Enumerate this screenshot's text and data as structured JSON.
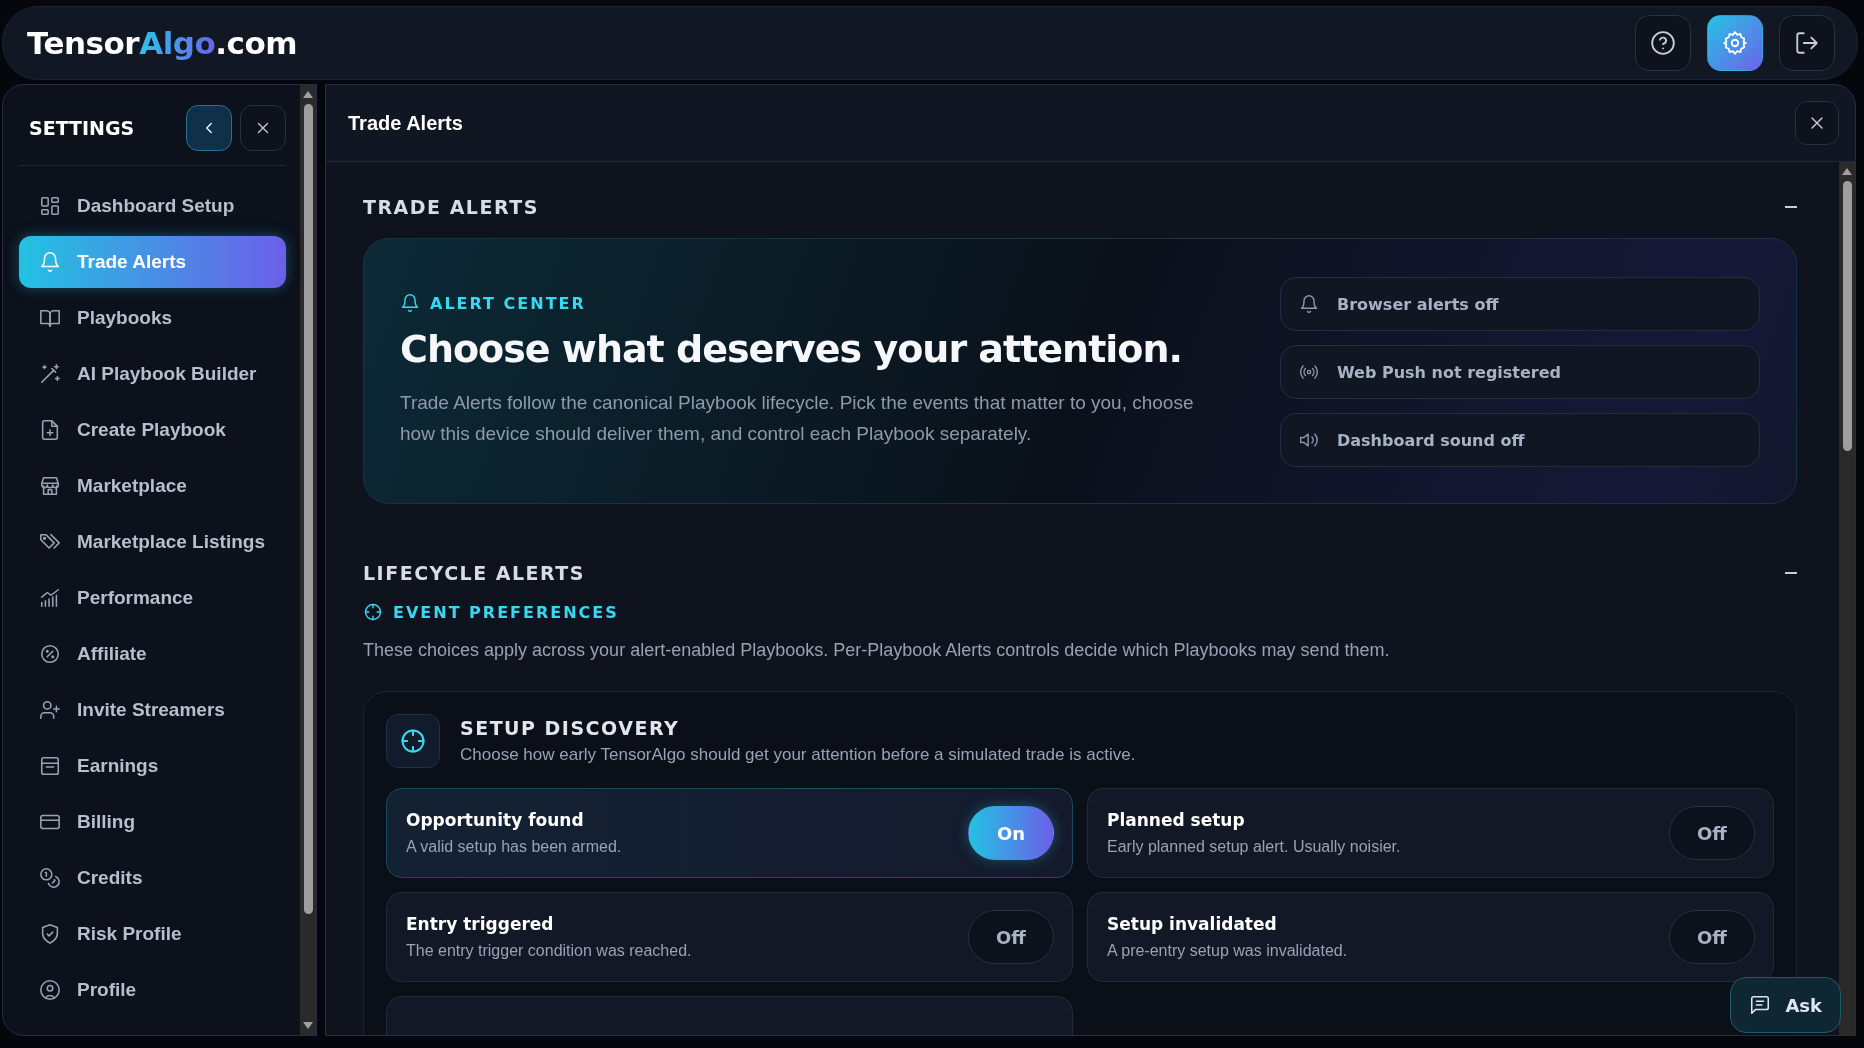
{
  "brand": [
    {
      "text": "Tensor",
      "kind": "plain"
    },
    {
      "text": "Algo",
      "kind": "accent"
    },
    {
      "text": ".com",
      "kind": "plain"
    }
  ],
  "header_actions": [
    {
      "kind": "help",
      "selected": false
    },
    {
      "kind": "settings",
      "selected": true
    },
    {
      "kind": "logout",
      "selected": false
    }
  ],
  "sidebar": {
    "title": "SETTINGS",
    "items": [
      {
        "label": "Dashboard Setup",
        "selected": false
      },
      {
        "label": "Trade Alerts",
        "selected": true
      },
      {
        "label": "Playbooks",
        "selected": false
      },
      {
        "label": "AI Playbook Builder",
        "selected": false
      },
      {
        "label": "Create Playbook",
        "selected": false
      },
      {
        "label": "Marketplace",
        "selected": false
      },
      {
        "label": "Marketplace Listings",
        "selected": false
      },
      {
        "label": "Performance",
        "selected": false
      },
      {
        "label": "Affiliate",
        "selected": false
      },
      {
        "label": "Invite Streamers",
        "selected": false
      },
      {
        "label": "Earnings",
        "selected": false
      },
      {
        "label": "Billing",
        "selected": false
      },
      {
        "label": "Credits",
        "selected": false
      },
      {
        "label": "Risk Profile",
        "selected": false
      },
      {
        "label": "Profile",
        "selected": false
      }
    ]
  },
  "panel": {
    "title": "Trade Alerts",
    "trade_alerts": {
      "heading": "TRADE ALERTS",
      "eyebrow": "ALERT CENTER",
      "title": "Choose what deserves your attention.",
      "text": "Trade Alerts follow the canonical Playbook lifecycle. Pick the events that matter to you, choose how this device should deliver them, and control each Playbook separately.",
      "statuses": [
        {
          "label": "Browser alerts off"
        },
        {
          "label": "Web Push not registered"
        },
        {
          "label": "Dashboard sound off"
        }
      ]
    },
    "lifecycle": {
      "heading": "LIFECYCLE ALERTS",
      "eyebrow": "EVENT PREFERENCES",
      "text": "These choices apply across your alert-enabled Playbooks. Per-Playbook Alerts controls decide which Playbooks may send them.",
      "group": {
        "title": "SETUP DISCOVERY",
        "text": "Choose how early TensorAlgo should get your attention before a simulated trade is active.",
        "events": [
          {
            "title": "Opportunity found",
            "text": "A valid setup has been armed.",
            "on": true,
            "toggle": "On"
          },
          {
            "title": "Planned setup",
            "text": "Early planned setup alert. Usually noisier.",
            "on": false,
            "toggle": "Off"
          },
          {
            "title": "Entry triggered",
            "text": "The entry trigger condition was reached.",
            "on": false,
            "toggle": "Off"
          },
          {
            "title": "Setup invalidated",
            "text": "A pre-entry setup was invalidated.",
            "on": false,
            "toggle": "Off"
          }
        ]
      }
    }
  },
  "ask_button": "Ask"
}
